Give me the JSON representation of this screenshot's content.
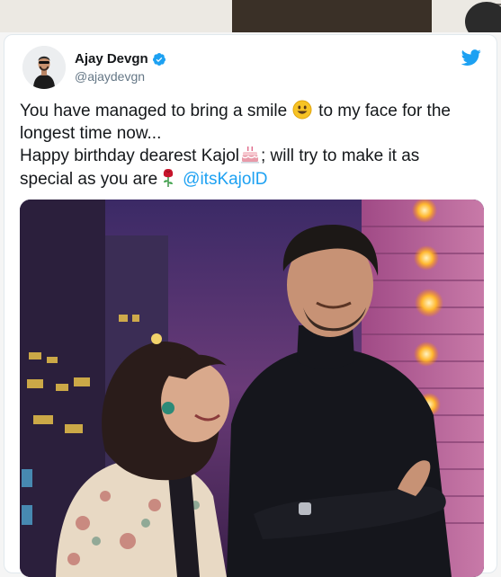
{
  "tweet": {
    "author_name": "Ajay Devgn",
    "author_handle": "@ajaydevgn",
    "verified": true,
    "text": {
      "line1_a": "You have managed to bring a smile",
      "line1_b": "to my face for the",
      "line2": "longest time now...",
      "line3_a": "Happy birthday dearest Kajol",
      "line3_b": "; will try to make it as",
      "line4_a": "special as you are",
      "mention": "@itsKajolD"
    },
    "emojis": [
      "smiley-icon",
      "birthday-cake-icon",
      "rose-icon"
    ],
    "colors": {
      "link": "#1da1f2",
      "verified": "#1da1f2",
      "text": "#14171a",
      "handle": "#657786"
    }
  }
}
